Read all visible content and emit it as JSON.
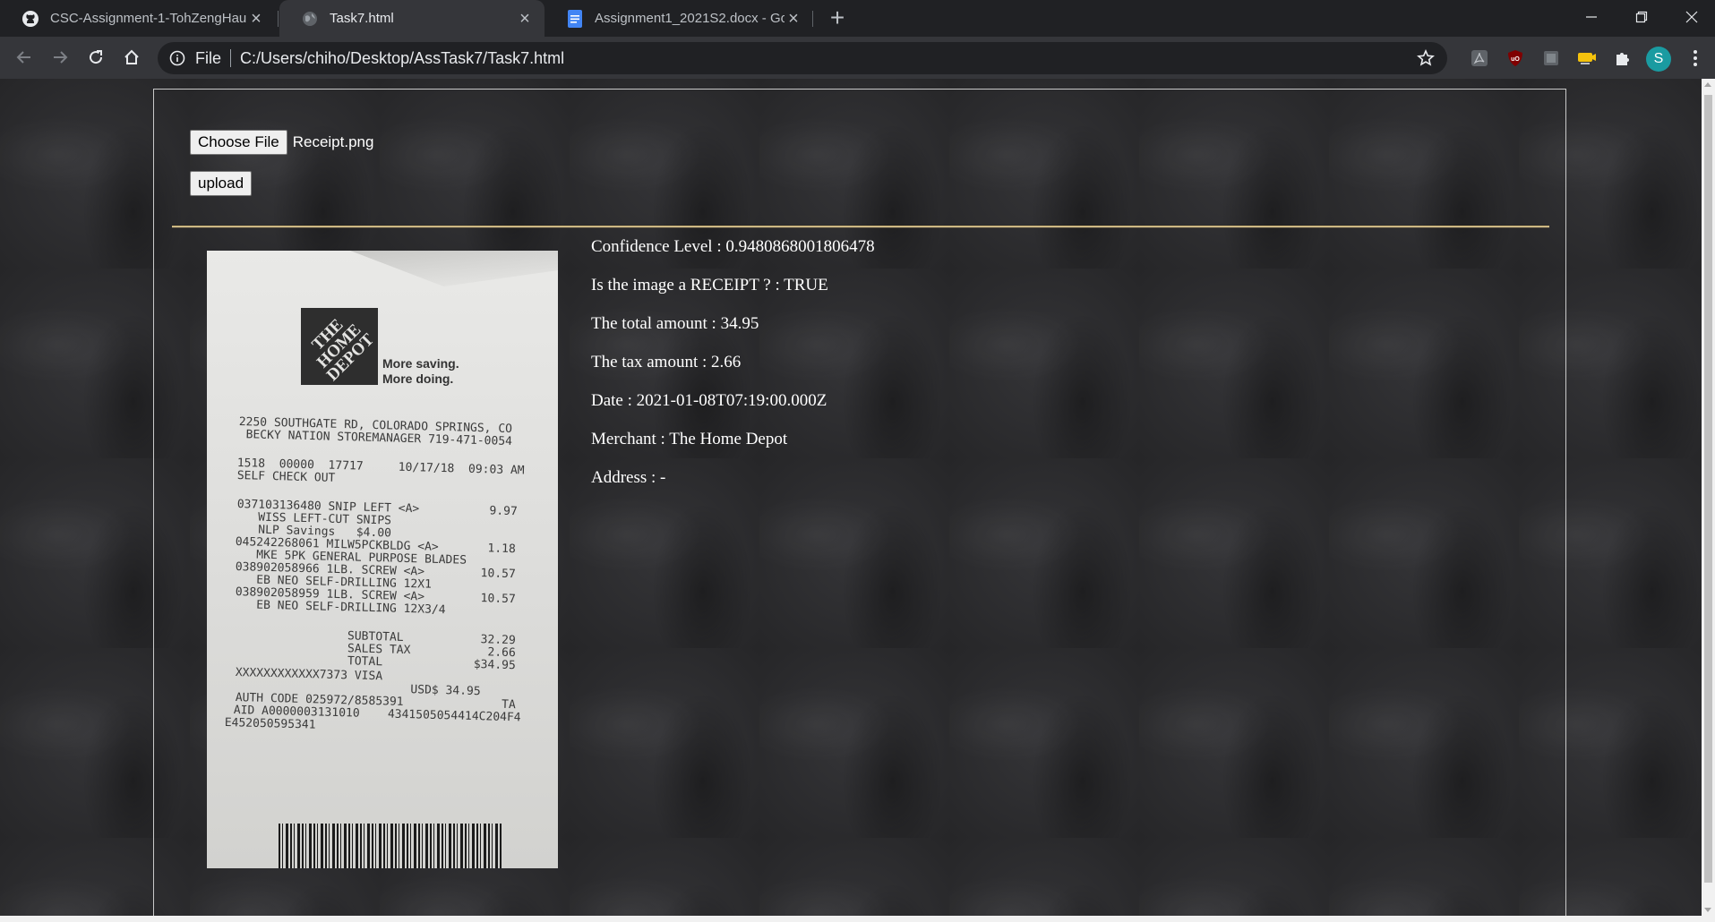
{
  "browser": {
    "tabs": [
      {
        "title": "CSC-Assignment-1-TohZengHau",
        "icon": "github-icon"
      },
      {
        "title": "Task7.html",
        "icon": "globe-icon"
      },
      {
        "title": "Assignment1_2021S2.docx - Goo",
        "icon": "google-docs-icon"
      }
    ],
    "active_tab_index": 1,
    "address": {
      "scheme": "File",
      "path": "C:/Users/chiho/Desktop/AssTask7/Task7.html"
    },
    "profile_initial": "S"
  },
  "page": {
    "choose_file_label": "Choose File",
    "selected_file": "Receipt.png",
    "upload_label": "upload",
    "results": [
      "Confidence Level : 0.9480868001806478",
      "Is the image a RECEIPT ? : TRUE",
      "The total amount : 34.95",
      "The tax amount : 2.66",
      "Date : 2021-01-08T07:19:00.000Z",
      "Merchant : The Home Depot",
      "Address : -"
    ]
  },
  "receipt_image": {
    "logo_text": "THE HOME DEPOT",
    "slogan": [
      "More saving.",
      "More doing."
    ],
    "lines": [
      "2250 SOUTHGATE RD, COLORADO SPRINGS, CO",
      " BECKY NATION STOREMANAGER 719-471-0054",
      "",
      "1518  00000  17717     10/17/18  09:03 AM",
      "SELF CHECK OUT",
      "",
      "037103136480 SNIP LEFT <A>          9.97",
      "   WISS LEFT-CUT SNIPS",
      "   NLP Savings   $4.00",
      "045242268061 MILW5PCKBLDG <A>       1.18",
      "   MKE 5PK GENERAL PURPOSE BLADES",
      "038902058966 1LB. SCREW <A>        10.57",
      "   EB NEO SELF-DRILLING 12X1",
      "038902058959 1LB. SCREW <A>        10.57",
      "   EB NEO SELF-DRILLING 12X3/4",
      "",
      "                SUBTOTAL           32.29",
      "                SALES TAX           2.66",
      "                TOTAL             $34.95",
      "XXXXXXXXXXXX7373 VISA",
      "                         USD$ 34.95",
      "AUTH CODE 025972/8585391              TA",
      "AID A0000003131010    4341505054414C204F4",
      "E452050595341"
    ]
  }
}
